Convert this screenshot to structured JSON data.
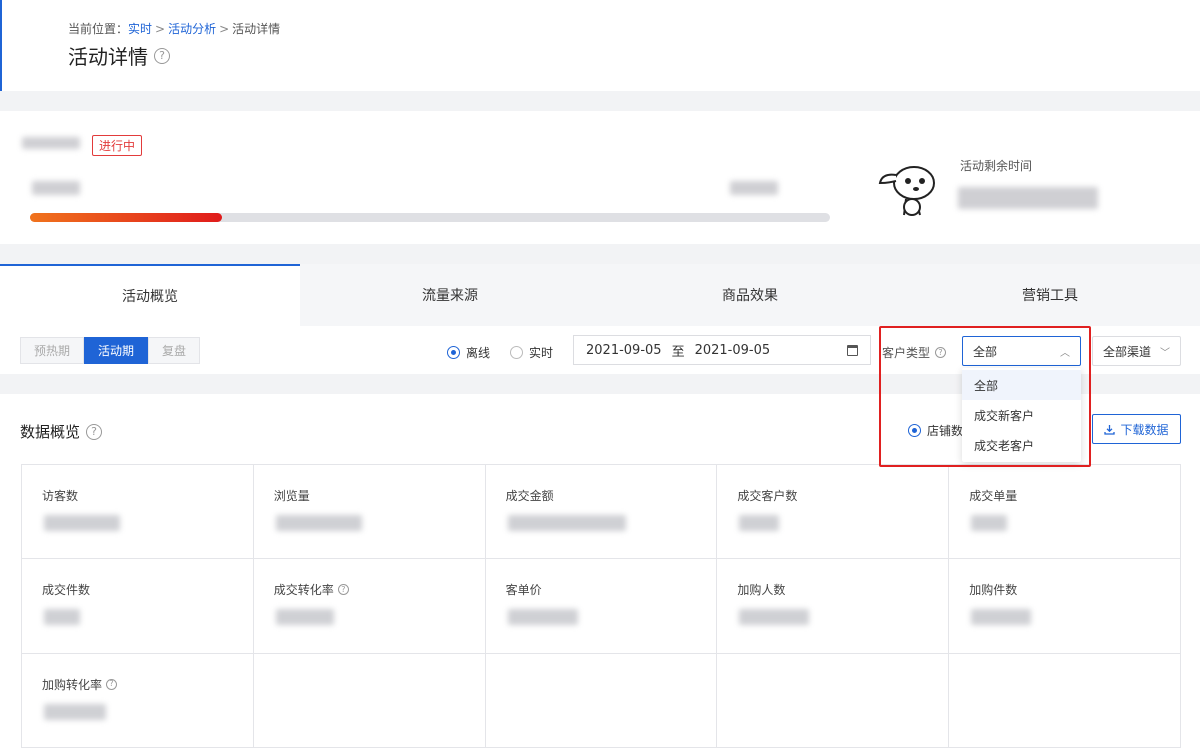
{
  "breadcrumb": {
    "prefix": "当前位置：",
    "items": [
      "实时",
      "活动分析",
      "活动详情"
    ],
    "separator": ">"
  },
  "page_title": "活动详情",
  "activity": {
    "status": "进行中",
    "remaining_label": "活动剩余时间",
    "progress_fraction": 0.24
  },
  "tabs": [
    "活动概览",
    "流量来源",
    "商品效果",
    "营销工具"
  ],
  "active_tab": 0,
  "periods": [
    "预热期",
    "活动期",
    "复盘"
  ],
  "active_period": 1,
  "mode_radios": [
    {
      "label": "离线",
      "checked": true
    },
    {
      "label": "实时",
      "checked": false
    }
  ],
  "date_range": {
    "start": "2021-09-05",
    "separator": "至",
    "end": "2021-09-05"
  },
  "customer_type": {
    "label": "客户类型",
    "selected": "全部",
    "options": [
      "全部",
      "成交新客户",
      "成交老客户"
    ]
  },
  "channel_select": {
    "selected": "全部渠道"
  },
  "overview": {
    "title": "数据概览",
    "scope_radio": "店铺数",
    "download_label": "下载数据",
    "metrics": [
      {
        "label": "访客数",
        "help": false
      },
      {
        "label": "浏览量",
        "help": false
      },
      {
        "label": "成交金额",
        "help": false
      },
      {
        "label": "成交客户数",
        "help": false
      },
      {
        "label": "成交单量",
        "help": false
      },
      {
        "label": "成交件数",
        "help": false
      },
      {
        "label": "成交转化率",
        "help": true
      },
      {
        "label": "客单价",
        "help": false
      },
      {
        "label": "加购人数",
        "help": false
      },
      {
        "label": "加购件数",
        "help": false
      },
      {
        "label": "加购转化率",
        "help": true
      }
    ]
  },
  "icons": {
    "help": "question-circle-icon",
    "calendar": "calendar-icon",
    "chevron": "chevron-down-icon",
    "download": "download-icon",
    "mascot": "jd-dog-mascot"
  },
  "colors": {
    "accent": "#1f64d6",
    "danger": "#e23b3b",
    "progress_start": "#f0731d",
    "progress_end": "#e01b1b"
  }
}
